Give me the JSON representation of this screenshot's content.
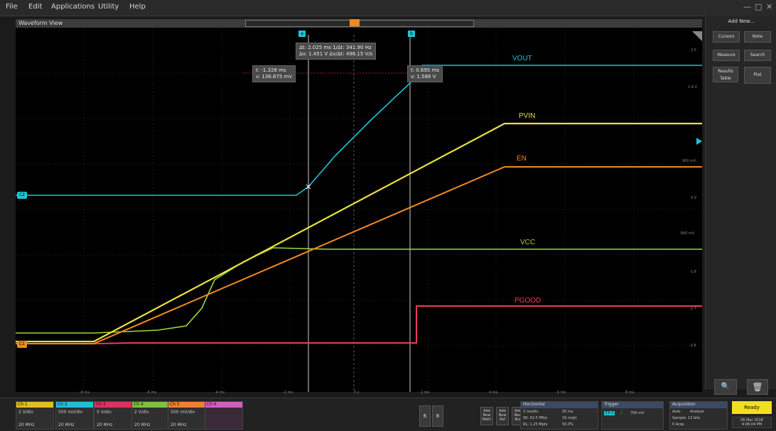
{
  "menu": {
    "file": "File",
    "edit": "Edit",
    "applications": "Applications",
    "utility": "Utility",
    "help": "Help"
  },
  "window_controls": {
    "minimize": "—",
    "restore": "□",
    "close": "✕"
  },
  "waveform_title": "Waveform View",
  "cursor_markers": {
    "a": "a",
    "b": "b"
  },
  "delta_readout": {
    "line1": "Δt: 2.025 ms    1/Δt: 341.90 Hz",
    "line2": "Δv: 1.451 V    Δv/Δt: 496.15 V/s"
  },
  "cursor_a_readout": {
    "t": "t: -1.328 ms",
    "v": "v: 136.875 mV"
  },
  "cursor_b_readout": {
    "t": "t: 0.695 ms",
    "v": "v: 1.588 V"
  },
  "traces": {
    "vout": "VOUT",
    "pvin": "PVIN",
    "en": "EN",
    "vcc": "VCC",
    "pgood": "PGOOD"
  },
  "ref_markers": {
    "ch2": "C2",
    "ch1": "C1"
  },
  "y_ticks": [
    "2.5",
    "1.8 V",
    "900 mV",
    "0 V",
    "-900 mV",
    "-1.8",
    "-2.7",
    "-3.6"
  ],
  "x_ticks": [
    "-8 ms",
    "-6 ms",
    "-4 ms",
    "-2 ms",
    "0 s",
    "2 ms",
    "4 ms",
    "6 ms",
    "8 ms"
  ],
  "right_panel": {
    "add_new": "Add New...",
    "buttons": [
      "Cursors",
      "Note",
      "Measure",
      "Search",
      "Results Table",
      "Plot"
    ],
    "zoom_icon": "zoom-icon",
    "trash_icon": "trash-icon"
  },
  "channels": [
    {
      "name": "Ch 1",
      "scale": "2 V/div",
      "bw": "20 MHz",
      "color": "#e0c020"
    },
    {
      "name": "Ch 2",
      "scale": "500 mV/div",
      "bw": "20 MHz",
      "color": "#20c0d0"
    },
    {
      "name": "Ch 3",
      "scale": "5 V/div",
      "bw": "20 MHz",
      "color": "#e03060"
    },
    {
      "name": "Ch 4",
      "scale": "2 V/div",
      "bw": "20 MHz",
      "color": "#80c040"
    },
    {
      "name": "Ch 5",
      "scale": "500 mV/div",
      "bw": "20 MHz",
      "color": "#f08030"
    },
    {
      "name": "Ch 6",
      "scale": "",
      "bw": "",
      "color": "#d060c0"
    }
  ],
  "mini_buttons": [
    "6",
    "8"
  ],
  "small_buttons": [
    "Add New Math",
    "Add New Ref",
    "Add New Bus"
  ],
  "horizontal": {
    "title": "Horizontal",
    "scale": "2 ms/div",
    "record": "20 ms",
    "sr": "SR: 62.5 MS/s",
    "pts": "16 ns/pt",
    "rl": "RL: 1.25 Mpts",
    "pos": "50.0%"
  },
  "trigger": {
    "title": "Trigger",
    "ch": "Ch 1",
    "level": "700 mV"
  },
  "acquisition": {
    "title": "Acquisition",
    "mode": "Auto",
    "analyze": "Analyze",
    "sample": "Sample: 12 bits",
    "acqs": "0 Acqs"
  },
  "status": {
    "ready": "Ready",
    "date": "06 Mar 2018",
    "time": "4:06:04 PM"
  },
  "colors": {
    "vout": "#1ec4d6",
    "pvin": "#e8e040",
    "en": "#f08a1e",
    "vcc": "#9cd83c",
    "pgood": "#f03a5a",
    "cursor": "#d8d8d8",
    "ready_bg": "#f0e020"
  }
}
